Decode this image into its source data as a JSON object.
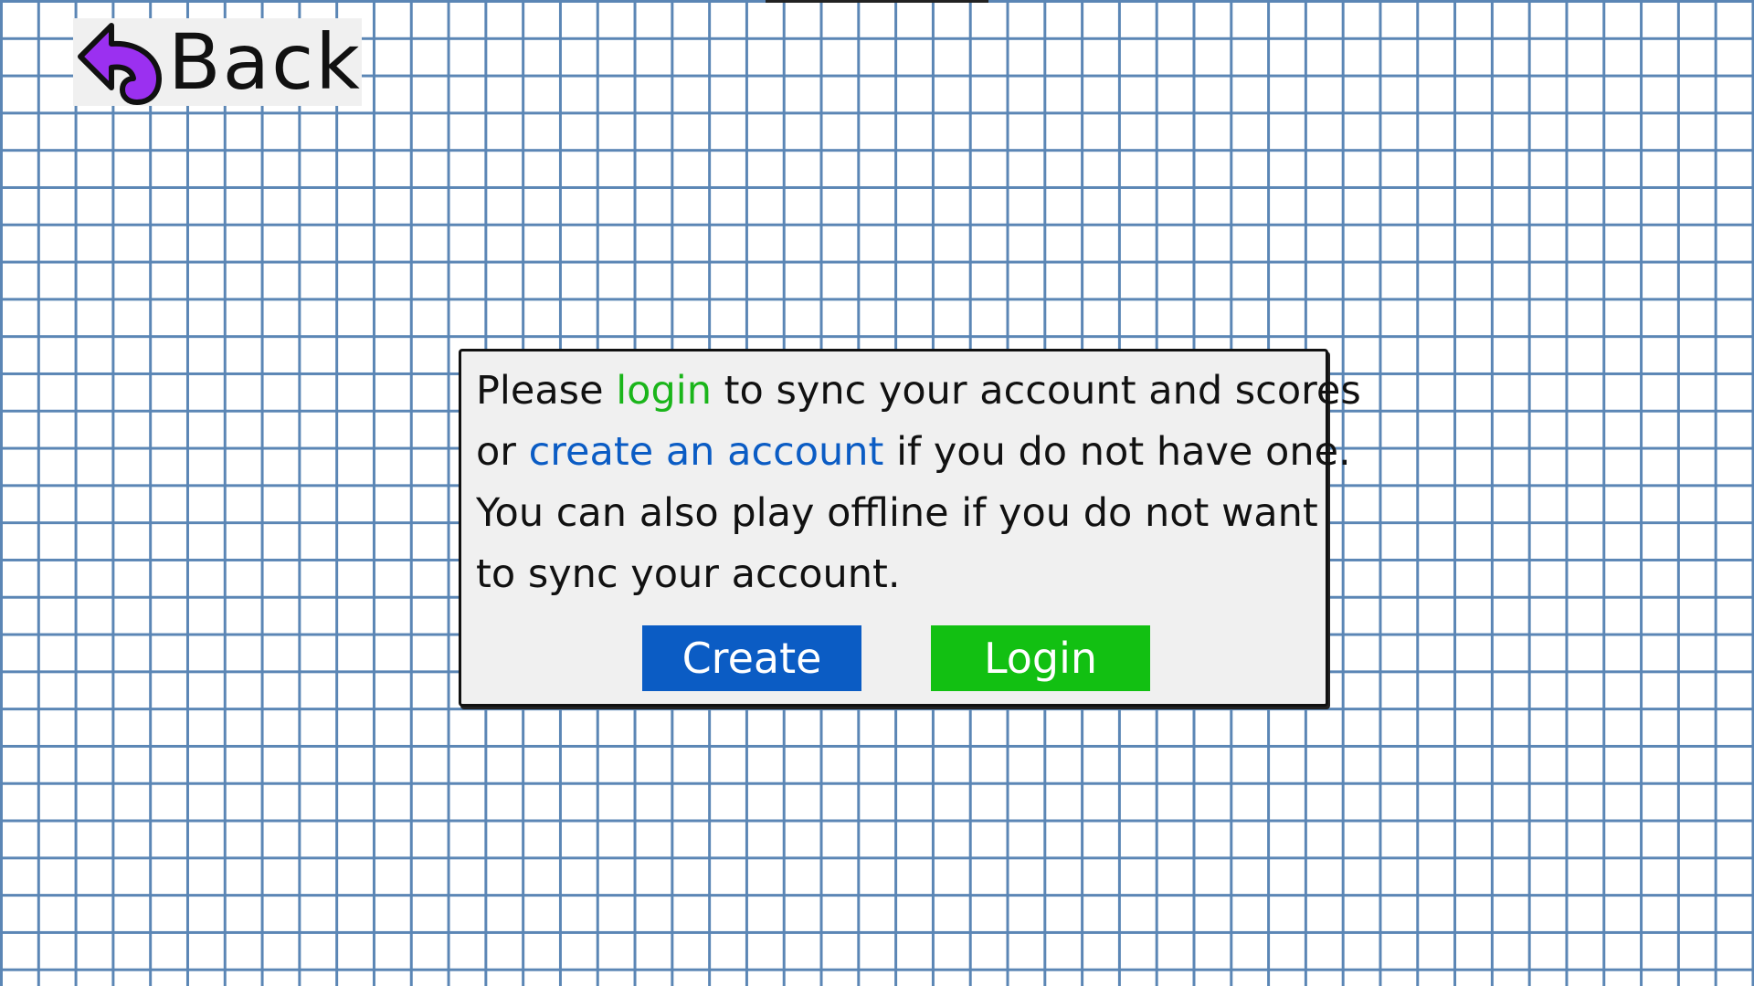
{
  "back_button": {
    "label": "Back",
    "icon": "undo-arrow-icon",
    "icon_color": "#9b30f0"
  },
  "dialog": {
    "line1": {
      "pre": "Please ",
      "link_login": "login",
      "post": " to sync your account and scores"
    },
    "line2": {
      "pre": "or ",
      "link_create": "create an account",
      "post": " if you do not have one."
    },
    "line3": "You can also play offline if you do not want",
    "line4": "to sync your account.",
    "create_button": "Create",
    "login_button": "Login"
  },
  "colors": {
    "grid_line": "#5b86b5",
    "dialog_bg": "#f0f0f0",
    "create_blue": "#0b5cc4",
    "login_green": "#12c012",
    "login_link_green": "#1ab51a",
    "create_link_blue": "#0b5cc4"
  }
}
